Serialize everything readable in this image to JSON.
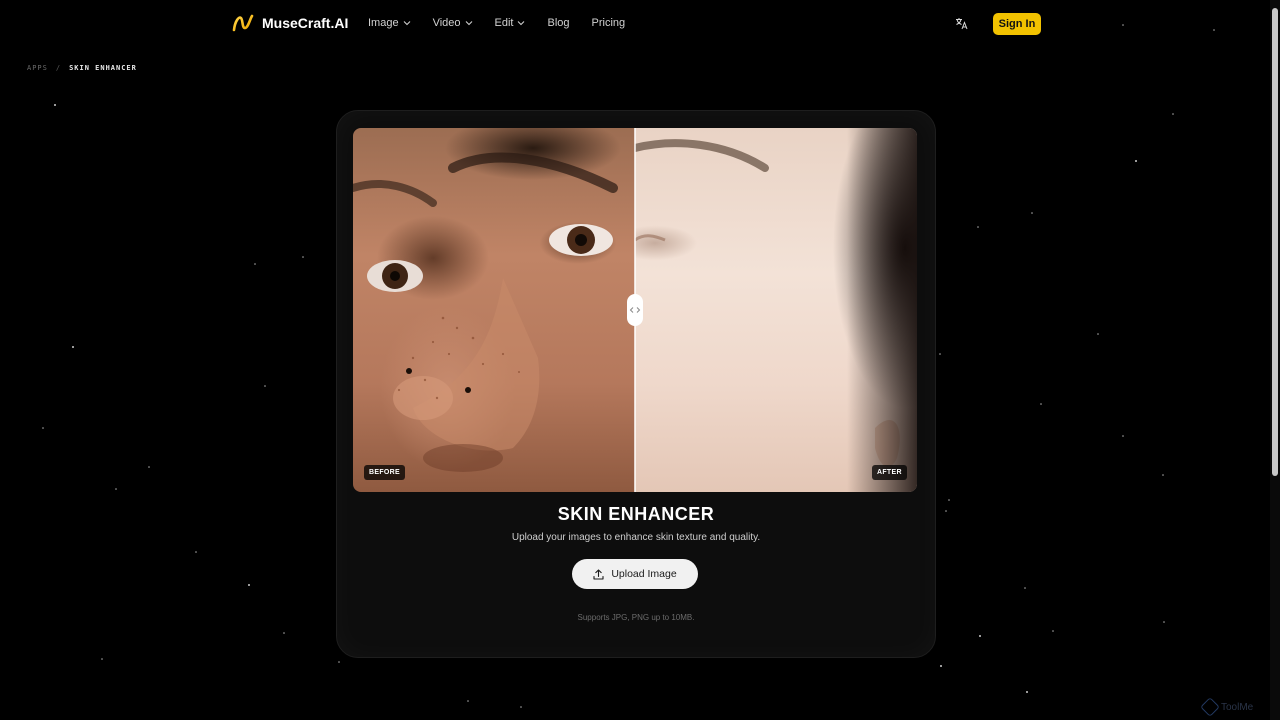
{
  "header": {
    "brand": "MuseCraft.AI",
    "nav": [
      {
        "label": "Image",
        "dropdown": true
      },
      {
        "label": "Video",
        "dropdown": true
      },
      {
        "label": "Edit",
        "dropdown": true
      },
      {
        "label": "Blog",
        "dropdown": false
      },
      {
        "label": "Pricing",
        "dropdown": false
      }
    ],
    "translate_icon": "translate-icon",
    "signin_label": "Sign In"
  },
  "breadcrumb": {
    "parent": "APPS",
    "separator": "/",
    "current": "SKIN ENHANCER"
  },
  "comparison": {
    "before_label": "BEFORE",
    "after_label": "AFTER",
    "handle_icon": "compare-handle-icon"
  },
  "tool": {
    "title": "SKIN ENHANCER",
    "subtitle": "Upload your images to enhance skin texture and quality.",
    "upload_label": "Upload Image",
    "upload_icon": "upload-icon",
    "supports_text": "Supports JPG, PNG up to 10MB."
  },
  "watermark": {
    "text": "ToolMe"
  },
  "colors": {
    "accent": "#f2c200",
    "background": "#000000",
    "card": "#0d0d0d"
  }
}
